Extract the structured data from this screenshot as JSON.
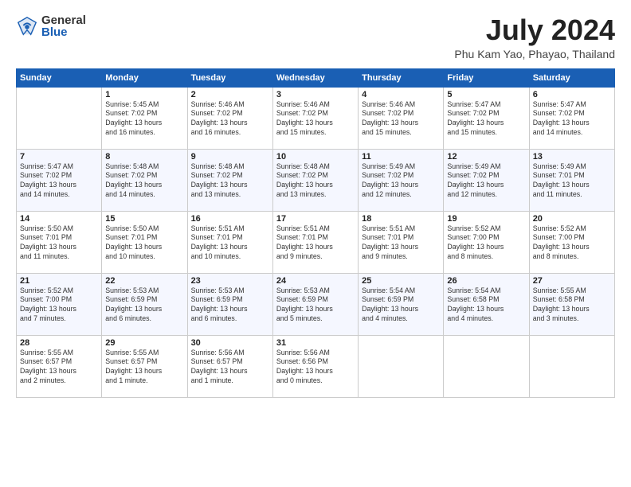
{
  "logo": {
    "general": "General",
    "blue": "Blue"
  },
  "title": "July 2024",
  "location": "Phu Kam Yao, Phayao, Thailand",
  "headers": [
    "Sunday",
    "Monday",
    "Tuesday",
    "Wednesday",
    "Thursday",
    "Friday",
    "Saturday"
  ],
  "weeks": [
    [
      {
        "day": "",
        "info": ""
      },
      {
        "day": "1",
        "info": "Sunrise: 5:45 AM\nSunset: 7:02 PM\nDaylight: 13 hours\nand 16 minutes."
      },
      {
        "day": "2",
        "info": "Sunrise: 5:46 AM\nSunset: 7:02 PM\nDaylight: 13 hours\nand 16 minutes."
      },
      {
        "day": "3",
        "info": "Sunrise: 5:46 AM\nSunset: 7:02 PM\nDaylight: 13 hours\nand 15 minutes."
      },
      {
        "day": "4",
        "info": "Sunrise: 5:46 AM\nSunset: 7:02 PM\nDaylight: 13 hours\nand 15 minutes."
      },
      {
        "day": "5",
        "info": "Sunrise: 5:47 AM\nSunset: 7:02 PM\nDaylight: 13 hours\nand 15 minutes."
      },
      {
        "day": "6",
        "info": "Sunrise: 5:47 AM\nSunset: 7:02 PM\nDaylight: 13 hours\nand 14 minutes."
      }
    ],
    [
      {
        "day": "7",
        "info": "Sunrise: 5:47 AM\nSunset: 7:02 PM\nDaylight: 13 hours\nand 14 minutes."
      },
      {
        "day": "8",
        "info": "Sunrise: 5:48 AM\nSunset: 7:02 PM\nDaylight: 13 hours\nand 14 minutes."
      },
      {
        "day": "9",
        "info": "Sunrise: 5:48 AM\nSunset: 7:02 PM\nDaylight: 13 hours\nand 13 minutes."
      },
      {
        "day": "10",
        "info": "Sunrise: 5:48 AM\nSunset: 7:02 PM\nDaylight: 13 hours\nand 13 minutes."
      },
      {
        "day": "11",
        "info": "Sunrise: 5:49 AM\nSunset: 7:02 PM\nDaylight: 13 hours\nand 12 minutes."
      },
      {
        "day": "12",
        "info": "Sunrise: 5:49 AM\nSunset: 7:02 PM\nDaylight: 13 hours\nand 12 minutes."
      },
      {
        "day": "13",
        "info": "Sunrise: 5:49 AM\nSunset: 7:01 PM\nDaylight: 13 hours\nand 11 minutes."
      }
    ],
    [
      {
        "day": "14",
        "info": "Sunrise: 5:50 AM\nSunset: 7:01 PM\nDaylight: 13 hours\nand 11 minutes."
      },
      {
        "day": "15",
        "info": "Sunrise: 5:50 AM\nSunset: 7:01 PM\nDaylight: 13 hours\nand 10 minutes."
      },
      {
        "day": "16",
        "info": "Sunrise: 5:51 AM\nSunset: 7:01 PM\nDaylight: 13 hours\nand 10 minutes."
      },
      {
        "day": "17",
        "info": "Sunrise: 5:51 AM\nSunset: 7:01 PM\nDaylight: 13 hours\nand 9 minutes."
      },
      {
        "day": "18",
        "info": "Sunrise: 5:51 AM\nSunset: 7:01 PM\nDaylight: 13 hours\nand 9 minutes."
      },
      {
        "day": "19",
        "info": "Sunrise: 5:52 AM\nSunset: 7:00 PM\nDaylight: 13 hours\nand 8 minutes."
      },
      {
        "day": "20",
        "info": "Sunrise: 5:52 AM\nSunset: 7:00 PM\nDaylight: 13 hours\nand 8 minutes."
      }
    ],
    [
      {
        "day": "21",
        "info": "Sunrise: 5:52 AM\nSunset: 7:00 PM\nDaylight: 13 hours\nand 7 minutes."
      },
      {
        "day": "22",
        "info": "Sunrise: 5:53 AM\nSunset: 6:59 PM\nDaylight: 13 hours\nand 6 minutes."
      },
      {
        "day": "23",
        "info": "Sunrise: 5:53 AM\nSunset: 6:59 PM\nDaylight: 13 hours\nand 6 minutes."
      },
      {
        "day": "24",
        "info": "Sunrise: 5:53 AM\nSunset: 6:59 PM\nDaylight: 13 hours\nand 5 minutes."
      },
      {
        "day": "25",
        "info": "Sunrise: 5:54 AM\nSunset: 6:59 PM\nDaylight: 13 hours\nand 4 minutes."
      },
      {
        "day": "26",
        "info": "Sunrise: 5:54 AM\nSunset: 6:58 PM\nDaylight: 13 hours\nand 4 minutes."
      },
      {
        "day": "27",
        "info": "Sunrise: 5:55 AM\nSunset: 6:58 PM\nDaylight: 13 hours\nand 3 minutes."
      }
    ],
    [
      {
        "day": "28",
        "info": "Sunrise: 5:55 AM\nSunset: 6:57 PM\nDaylight: 13 hours\nand 2 minutes."
      },
      {
        "day": "29",
        "info": "Sunrise: 5:55 AM\nSunset: 6:57 PM\nDaylight: 13 hours\nand 1 minute."
      },
      {
        "day": "30",
        "info": "Sunrise: 5:56 AM\nSunset: 6:57 PM\nDaylight: 13 hours\nand 1 minute."
      },
      {
        "day": "31",
        "info": "Sunrise: 5:56 AM\nSunset: 6:56 PM\nDaylight: 13 hours\nand 0 minutes."
      },
      {
        "day": "",
        "info": ""
      },
      {
        "day": "",
        "info": ""
      },
      {
        "day": "",
        "info": ""
      }
    ]
  ]
}
